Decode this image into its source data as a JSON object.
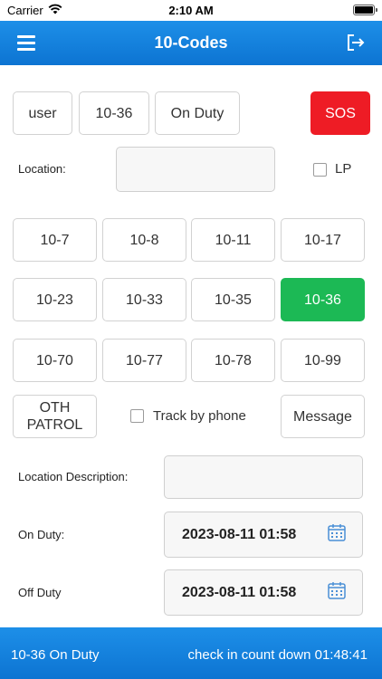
{
  "status_bar": {
    "carrier": "Carrier",
    "time": "2:10 AM"
  },
  "header": {
    "title": "10-Codes"
  },
  "status_row": {
    "user": "user",
    "code": "10-36",
    "duty": "On Duty",
    "sos": "SOS"
  },
  "location": {
    "label": "Location:",
    "value": "",
    "lp_label": "LP"
  },
  "codes": [
    "10-7",
    "10-8",
    "10-11",
    "10-17",
    "10-23",
    "10-33",
    "10-35",
    "10-36",
    "10-70",
    "10-77",
    "10-78",
    "10-99"
  ],
  "selected_code": "10-36",
  "oth_patrol": "OTH\nPATROL",
  "track_by_phone": "Track by phone",
  "message": "Message",
  "location_description": {
    "label": "Location Description:",
    "value": ""
  },
  "on_duty": {
    "label": "On Duty:",
    "value": "2023-08-11 01:58"
  },
  "off_duty": {
    "label": "Off Duty",
    "value": "2023-08-11 01:58"
  },
  "footer": {
    "status": "10-36 On Duty",
    "countdown": "check in count down 01:48:41"
  },
  "colors": {
    "header_blue": "#0d74d2",
    "sos_red": "#ee1c25",
    "active_green": "#1cb955"
  }
}
